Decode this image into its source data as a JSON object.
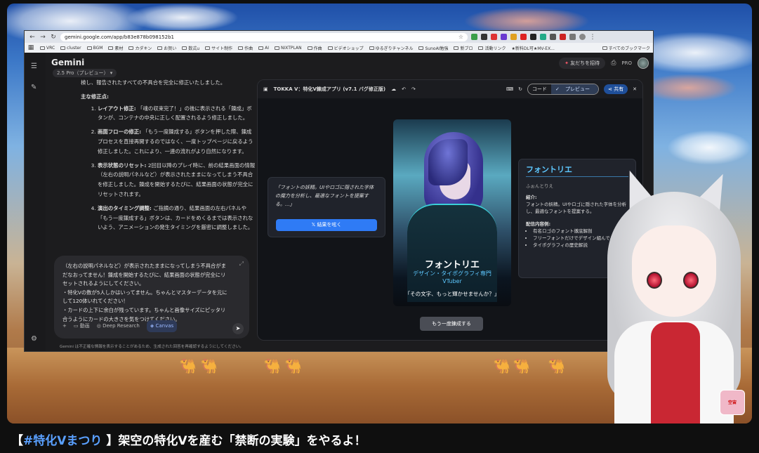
{
  "browser": {
    "url": "gemini.google.com/app/b83e878b098152b1",
    "bookmarks": [
      "VRC",
      "cluster",
      "BGM",
      "素材",
      "カダキン",
      "お賀い",
      "数式u",
      "サイト制作",
      "作曲",
      "AI",
      "NIXTPLAN",
      "作曲",
      "ビデオショップ",
      "ゆるぎりチャンネル",
      "SunoAI勉強",
      "新ブロ",
      "活動リンク",
      "★新料DL可★MV-EX..."
    ],
    "bookmarks_all": "すべてのブックマーク"
  },
  "gemini": {
    "app_title": "Gemini",
    "model": "2.5 Pro（プレビュー）",
    "invite": "友だちを招待",
    "pro": "PRO",
    "chat": {
      "intro": "検し、報告されたすべての不具合を完全に修正いたしました。",
      "heading": "主な修正点:",
      "items": [
        {
          "bold": "レイアウト修正:",
          "text": " 「魂の収束完了！」の後に表示される「錬成」ボタンが、コンテナの中央に正しく配置されるよう修正しました。"
        },
        {
          "bold": "画面フローの修正:",
          "text": " 「もう一度錬成する」ボタンを押した際、錬成プロセスを直接再開するのではなく、一度トップページに戻るよう修正しました。これにより、一連の流れがより自然になります。"
        },
        {
          "bold": "表示状態のリセット:",
          "text": " 2回目以降のプレイ時に、前の結果画面の情報（左右の説明パネルなど）が表示されたままになってしまう不具合を修正しました。錬成を開始するたびに、結果画面の状態が完全にリセットされます。"
        },
        {
          "bold": "演出のタイミング調整:",
          "text": " ご指摘の通り、結果画面の左右パネルや「もう一度錬成する」ボタンは、カードをめくるまでは表示されないよう、アニメーションの発生タイミングを厳密に調整しました。"
        }
      ]
    },
    "prompt": {
      "lines": [
        "（左右の説明パネルなど）が表示されたままになってしまう不具合がま",
        "だなおってません！錬成を開始するたびに、結果画面の状態が完全にリ",
        "セットされるようにしてください。",
        "・特化Vの数が5人しかはいってません。ちゃんとマスターデータを元に",
        "して120体いれてください！",
        "・カードの上下に余白が残っています。ちゃんと画像サイズにピッタリ",
        "合うようにカードの大きさを気をつけてください。"
      ],
      "tool_add": "+",
      "tool_video": "動画",
      "tool_research": "Deep Research",
      "tool_canvas": "Canvas"
    },
    "disclaimer": "Gemini は不正確な情報を表示することがあるため、生成された回答を再確認するようにしてください。"
  },
  "canvas": {
    "title": "TOKKA V：特化V錬成アプリ (v7.1 バグ修正版)",
    "code_label": "コード",
    "preview_label": "プレビュー",
    "share_label": "共有",
    "bubble_text": "「フォントの妖精。UIやロゴに隠された字体の魔力を分析し、最適なフォントを提案する。...」",
    "x_button": "結果を呟く",
    "card": {
      "name": "フォントリエ",
      "role": "デザイン・タイポグラフィ専門",
      "type": "VTuber",
      "quote": "「その文字、もっと輝かせませんか？」"
    },
    "info": {
      "title": "フォントリエ",
      "reading": "ふぉんとりえ",
      "intro_label": "紹介:",
      "intro_text": "フォントの妖精。UIやロゴに隠された字体を分析し、最適なフォントを提案する。",
      "content_label": "配信内容例:",
      "content_items": [
        "有名ロゴのフォント徹底解剖",
        "フリーフォントだけでデザイン組んでみた",
        "タイポグラフィの歴史解説"
      ]
    },
    "again_button": "もう一度錬成する"
  },
  "overlay": {
    "badge": "空宙",
    "caption_open": "【",
    "caption_tag": "#特化Vまつり",
    "caption_rest": " 】架空の特化Vを産む「禁断の実験」をやるよ！"
  }
}
